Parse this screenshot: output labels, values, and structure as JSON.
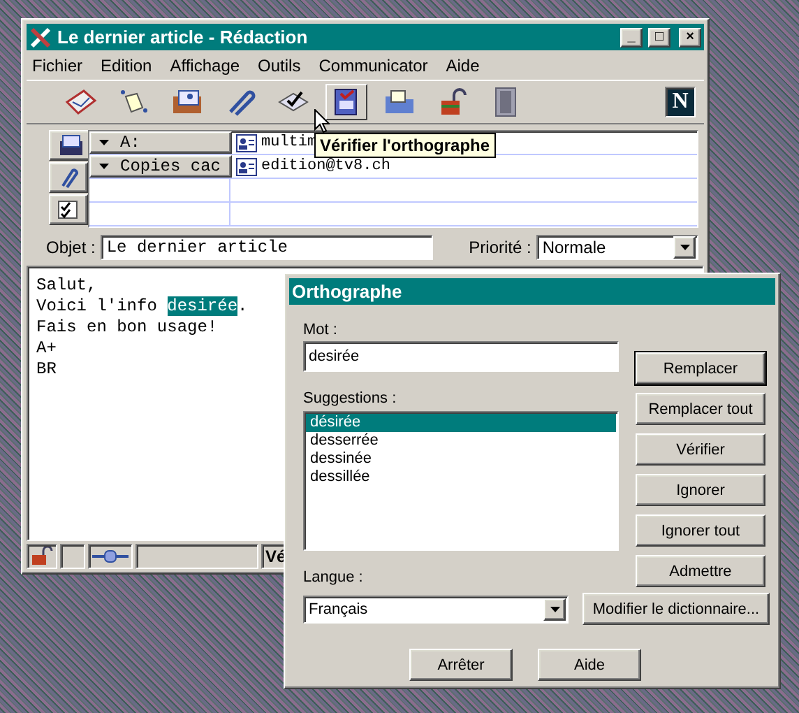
{
  "window": {
    "title": "Le dernier article - Rédaction",
    "controls": [
      "_",
      "□",
      "×"
    ]
  },
  "menu": [
    "Fichier",
    "Edition",
    "Affichage",
    "Outils",
    "Communicator",
    "Aide"
  ],
  "toolbar": [
    {
      "kind": "send",
      "hover": false
    },
    {
      "kind": "quote",
      "hover": false
    },
    {
      "kind": "address",
      "hover": false
    },
    {
      "kind": "attach",
      "hover": false
    },
    {
      "kind": "options",
      "hover": false
    },
    {
      "kind": "spelling",
      "hover": true
    },
    {
      "kind": "save",
      "hover": false
    },
    {
      "kind": "security",
      "hover": false
    },
    {
      "kind": "stop",
      "hover": false
    }
  ],
  "logo": "N",
  "tooltip": "Vérifier l'orthographe",
  "address_tabs": [
    {
      "kind": "address",
      "selected": true
    },
    {
      "kind": "attach",
      "selected": false
    },
    {
      "kind": "options",
      "selected": false
    }
  ],
  "recipients": [
    {
      "field": "A:",
      "value": "multim"
    },
    {
      "field": "Copies cac",
      "value": "edition@tv8.ch"
    }
  ],
  "subject": {
    "label": "Objet :",
    "value": "Le dernier article"
  },
  "priority": {
    "label": "Priorité :",
    "value": "Normale"
  },
  "body": [
    [
      {
        "text": "Salut,",
        "highlighted": false
      }
    ],
    [
      {
        "text": "Voici l'info ",
        "highlighted": false
      },
      {
        "text": "desirée",
        "highlighted": true
      },
      {
        "text": ".",
        "highlighted": false
      }
    ],
    [
      {
        "text": "Fais en bon usage!",
        "highlighted": false
      }
    ],
    [
      {
        "text": "A+",
        "highlighted": false
      }
    ],
    [
      {
        "text": "BR",
        "highlighted": false
      }
    ]
  ],
  "status_bar": {
    "text": "Vé"
  },
  "dialog": {
    "title": "Orthographe",
    "word_label": "Mot :",
    "word": "desirée",
    "suggestions_label": "Suggestions :",
    "suggestions": [
      {
        "text": "désirée",
        "selected": true
      },
      {
        "text": "desserrée",
        "selected": false
      },
      {
        "text": "dessinée",
        "selected": false
      },
      {
        "text": "dessillée",
        "selected": false
      }
    ],
    "language_label": "Langue :",
    "language": "Français",
    "side_buttons": [
      {
        "label": "Remplacer",
        "default": true
      },
      {
        "label": "Remplacer tout",
        "default": false
      },
      {
        "label": "Vérifier",
        "default": false
      },
      {
        "label": "Ignorer",
        "default": false
      },
      {
        "label": "Ignorer tout",
        "default": false
      },
      {
        "label": "Admettre",
        "default": false
      }
    ],
    "dictionary_button": "Modifier le dictionnaire...",
    "bottom_buttons": [
      "Arrêter",
      "Aide"
    ]
  }
}
